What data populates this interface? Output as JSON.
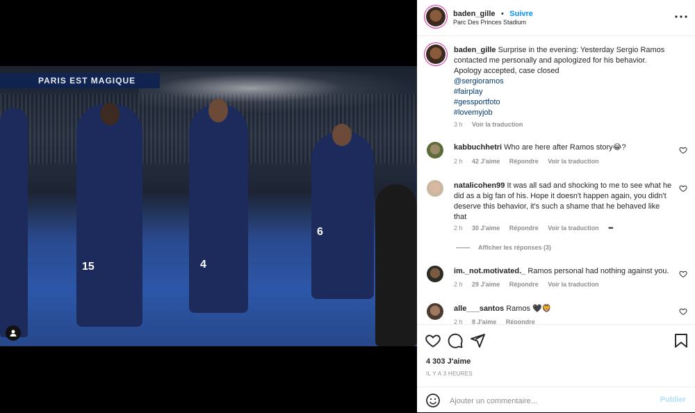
{
  "post": {
    "username": "baden_gille",
    "separator": "•",
    "follow_label": "Suivre",
    "location": "Parc Des Princes Stadium",
    "more_icon": "more-horizontal-icon"
  },
  "photo": {
    "banner_text": "PARIS EST MAGIQUE",
    "jersey_numbers": [
      "15",
      "4",
      "6"
    ]
  },
  "caption": {
    "username": "baden_gille",
    "text": "Surprise in the evening: Yesterday Sergio Ramos contacted me personally and apologized for his behavior. Apology accepted, case closed",
    "tags": [
      "@sergioramos",
      "#fairplay",
      "#gessportfoto",
      "#lovemyjob"
    ],
    "time": "3 h",
    "translate": "Voir la traduction"
  },
  "comments": [
    {
      "username": "kabbuchhetri",
      "text": "Who are here after Ramos story😂?",
      "time": "2 h",
      "likes": "42 J'aime",
      "reply": "Répondre",
      "translate": "Voir la traduction"
    },
    {
      "username": "natalicohen99",
      "text": "It was all sad and shocking to me to see what he did as a big fan of his. Hope it doesn't happen again, you didn't deserve this behavior, it's such a shame that he behaved like that",
      "time": "2 h",
      "likes": "30 J'aime",
      "reply": "Répondre",
      "translate": "Voir la traduction",
      "more": "•••",
      "replies_label": "Afficher les réponses (3)"
    },
    {
      "username": "im._not.motivated._",
      "text": "Ramos personal had nothing against you.",
      "time": "2 h",
      "likes": "29 J'aime",
      "reply": "Répondre",
      "translate": "Voir la traduction"
    },
    {
      "username": "alle___santos",
      "text": "Ramos 🖤🦁",
      "time": "2 h",
      "likes": "8 J'aime",
      "reply": "Répondre"
    }
  ],
  "engagement": {
    "likes": "4 303 J'aime",
    "timestamp": "IL Y A 3 HEURES"
  },
  "composer": {
    "placeholder": "Ajouter un commentaire...",
    "publish_label": "Publier"
  },
  "colors": {
    "accent": "#0095f6",
    "publish_disabled": "#b2dffc",
    "muted": "#8e8e8e"
  }
}
